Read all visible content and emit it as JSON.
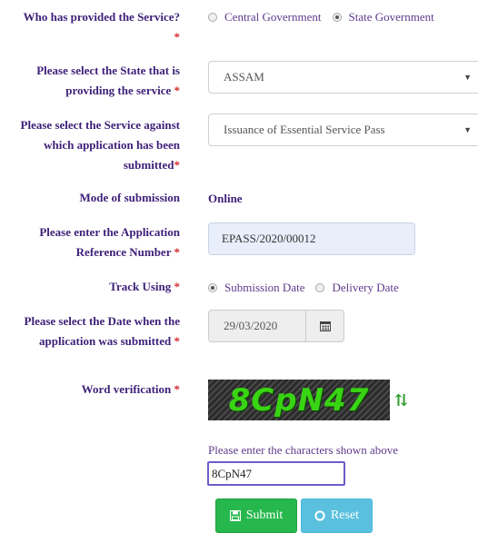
{
  "provider": {
    "label": "Who has provided the Service?",
    "required_mark": "*",
    "options": [
      "Central Government",
      "State Government"
    ],
    "selected": "State Government"
  },
  "state": {
    "label_line1": "Please select the State that is",
    "label_line2": "providing the service",
    "required_mark": "*",
    "value": "ASSAM"
  },
  "service": {
    "label_line1": "Please select the Service against",
    "label_line2": "which application has been",
    "label_line3": "submitted",
    "required_mark": "*",
    "value": "Issuance of Essential Service Pass"
  },
  "mode": {
    "label": "Mode of submission",
    "value": "Online"
  },
  "reference": {
    "label_line1": "Please enter the Application",
    "label_line2": "Reference Number",
    "required_mark": "*",
    "value": "EPASS/2020/00012"
  },
  "track": {
    "label": "Track Using",
    "required_mark": "*",
    "options": [
      "Submission Date",
      "Delivery Date"
    ],
    "selected": "Submission Date"
  },
  "date": {
    "label_line1": "Please select the Date when the",
    "label_line2": "application was submitted",
    "required_mark": "*",
    "value": "29/03/2020",
    "icon": "calendar-icon"
  },
  "verification": {
    "label": "Word verification",
    "required_mark": "*",
    "captcha_text": "8CpN47",
    "refresh_icon": "refresh-icon",
    "hint": "Please enter the characters shown above",
    "input_value": "8CpN47"
  },
  "buttons": {
    "submit_label": "Submit",
    "submit_icon": "save-icon",
    "reset_label": "Reset",
    "reset_icon": "circle-icon"
  }
}
